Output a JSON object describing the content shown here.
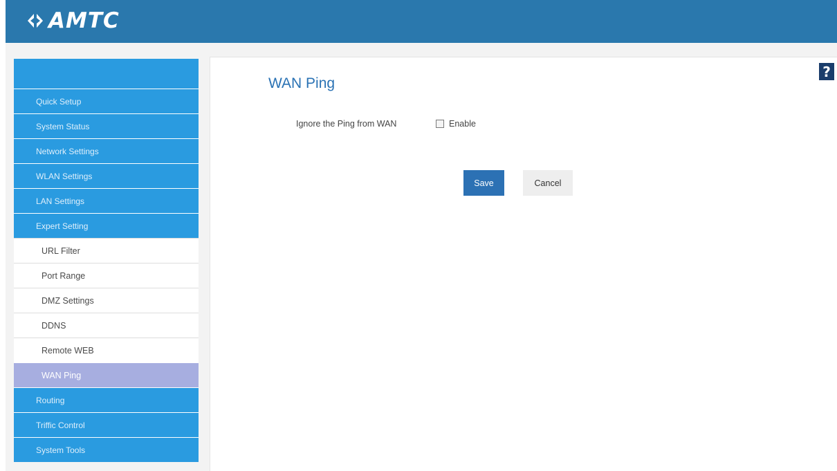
{
  "header": {
    "logo_text": "AMTC"
  },
  "sidebar": {
    "items": [
      {
        "label": "Quick Setup"
      },
      {
        "label": "System Status"
      },
      {
        "label": "Network Settings"
      },
      {
        "label": "WLAN Settings"
      },
      {
        "label": "LAN Settings"
      },
      {
        "label": "Expert Setting"
      }
    ],
    "sub_items": [
      {
        "label": "URL Filter"
      },
      {
        "label": "Port Range"
      },
      {
        "label": "DMZ Settings"
      },
      {
        "label": "DDNS"
      },
      {
        "label": "Remote WEB"
      },
      {
        "label": "WAN Ping",
        "active": true
      }
    ],
    "bottom_items": [
      {
        "label": "Routing"
      },
      {
        "label": "Triffic Control"
      },
      {
        "label": "System Tools"
      }
    ]
  },
  "help": {
    "icon": "help-icon",
    "label": "?"
  },
  "main": {
    "title": "WAN Ping",
    "field_label": "Ignore the Ping from WAN",
    "checkbox_label": "Enable",
    "checkbox_checked": false,
    "save_label": "Save",
    "cancel_label": "Cancel"
  },
  "colors": {
    "header": "#2a78ad",
    "sidebar": "#2a9be0",
    "active_item": "#a7aee0",
    "accent": "#2a72b4"
  }
}
